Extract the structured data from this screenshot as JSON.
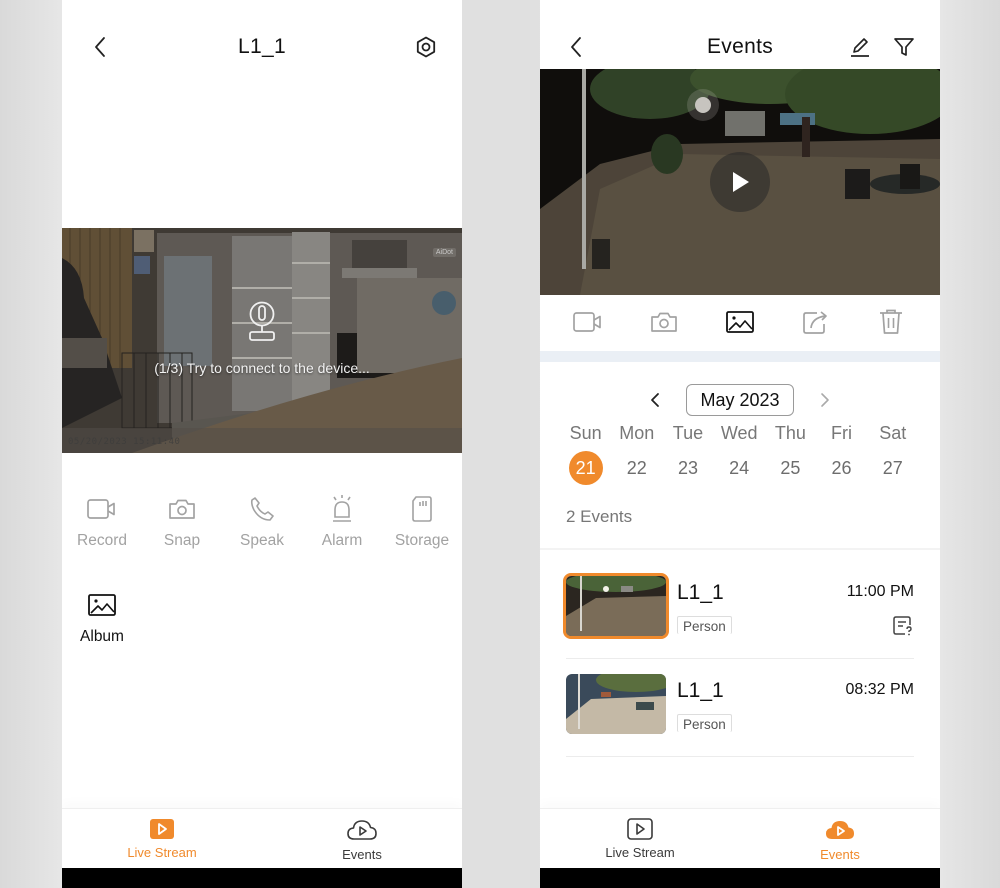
{
  "live_stream_screen": {
    "header": {
      "title": "L1_1",
      "back_icon": "chevron-left-icon",
      "settings_icon": "hexagon-gear-icon"
    },
    "video": {
      "status_message": "(1/3) Try to connect to the device...",
      "overlay_timestamp": "05/20/2023 15:11:40",
      "brand_watermark": "AiDot"
    },
    "actions": [
      {
        "label": "Record",
        "icon": "video-camera-icon",
        "enabled": false
      },
      {
        "label": "Snap",
        "icon": "camera-icon",
        "enabled": false
      },
      {
        "label": "Speak",
        "icon": "phone-icon",
        "enabled": false
      },
      {
        "label": "Alarm",
        "icon": "siren-icon",
        "enabled": false
      },
      {
        "label": "Storage",
        "icon": "sd-card-icon",
        "enabled": false
      },
      {
        "label": "Album",
        "icon": "image-icon",
        "enabled": true
      }
    ],
    "tabbar": {
      "tabs": [
        {
          "label": "Live Stream",
          "icon": "play-square-icon",
          "active": true
        },
        {
          "label": "Events",
          "icon": "cloud-play-icon",
          "active": false
        }
      ]
    }
  },
  "events_screen": {
    "header": {
      "title": "Events",
      "back_icon": "chevron-left-icon",
      "edit_icon": "pencil-icon",
      "filter_icon": "funnel-icon"
    },
    "media_toolbar": [
      {
        "name": "record",
        "icon": "video-camera-icon",
        "active": false
      },
      {
        "name": "snapshot",
        "icon": "camera-icon",
        "active": false
      },
      {
        "name": "album",
        "icon": "image-icon",
        "active": true
      },
      {
        "name": "share",
        "icon": "share-icon",
        "active": false
      },
      {
        "name": "delete",
        "icon": "trash-icon",
        "active": false
      }
    ],
    "calendar": {
      "month_label": "May 2023",
      "weekdays": [
        "Sun",
        "Mon",
        "Tue",
        "Wed",
        "Thu",
        "Fri",
        "Sat"
      ],
      "dates": [
        "21",
        "22",
        "23",
        "24",
        "25",
        "26",
        "27"
      ],
      "selected_date": "21"
    },
    "event_count_label": "2 Events",
    "events": [
      {
        "device": "L1_1",
        "time": "11:00 PM",
        "tag": "Person",
        "selected": true,
        "has_feedback_icon": true
      },
      {
        "device": "L1_1",
        "time": "08:32 PM",
        "tag": "Person",
        "selected": false,
        "has_feedback_icon": false
      }
    ],
    "tabbar": {
      "tabs": [
        {
          "label": "Live Stream",
          "icon": "play-square-icon",
          "active": false
        },
        {
          "label": "Events",
          "icon": "cloud-play-icon",
          "active": true
        }
      ]
    }
  },
  "colors": {
    "accent": "#f08a2c",
    "inactive_text": "#a2a2a2",
    "separator_band": "#eaeff5"
  }
}
